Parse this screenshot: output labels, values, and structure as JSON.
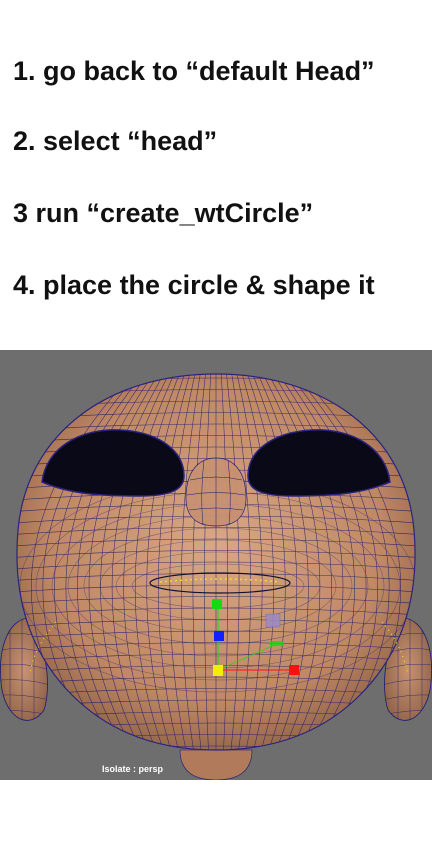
{
  "instructions": {
    "step1": "1. go back to “default Head”",
    "step2": "2. select “head”",
    "step3": "3 run “create_wtCircle”",
    "step4": "4. place the circle & shape it"
  },
  "viewport": {
    "hud_label": "Isolate : persp",
    "background_color": "#6e6e6e",
    "skin_color": "#c6906d",
    "wire_color": "#1c1a6e",
    "selection_color": "#e8e020",
    "manipulator": {
      "x_axis_color": "#ff1010",
      "y_axis_color": "#10dd10",
      "z_axis_color": "#1020ff",
      "center_color": "#f0f000",
      "plane_handle_color": "#9a8ac8"
    }
  }
}
